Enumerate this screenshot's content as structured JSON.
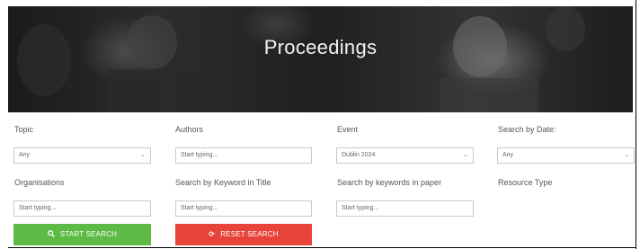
{
  "header": {
    "title": "Proceedings"
  },
  "filters": {
    "topic": {
      "label": "Topic",
      "value": "Any"
    },
    "authors": {
      "label": "Authors",
      "placeholder": "Start typing..."
    },
    "event": {
      "label": "Event",
      "value": "Dublin 2024"
    },
    "date": {
      "label": "Search by Date:",
      "value": "Any"
    },
    "organisations": {
      "label": "Organisations",
      "placeholder": "Start typing..."
    },
    "keyword_title": {
      "label": "Search by Keyword in Title",
      "placeholder": "Start typing..."
    },
    "keyword_paper": {
      "label": "Search by keywords in paper",
      "placeholder": "Start typing..."
    },
    "resource_type": {
      "label": "Resource Type"
    }
  },
  "actions": {
    "start_search": "START SEARCH",
    "reset_search": "RESET SEARCH"
  },
  "colors": {
    "green": "#5dbb45",
    "red": "#e8433a"
  },
  "icons": {
    "start": "search-icon",
    "reset": "refresh-icon",
    "select": "chevron-down-icon"
  }
}
